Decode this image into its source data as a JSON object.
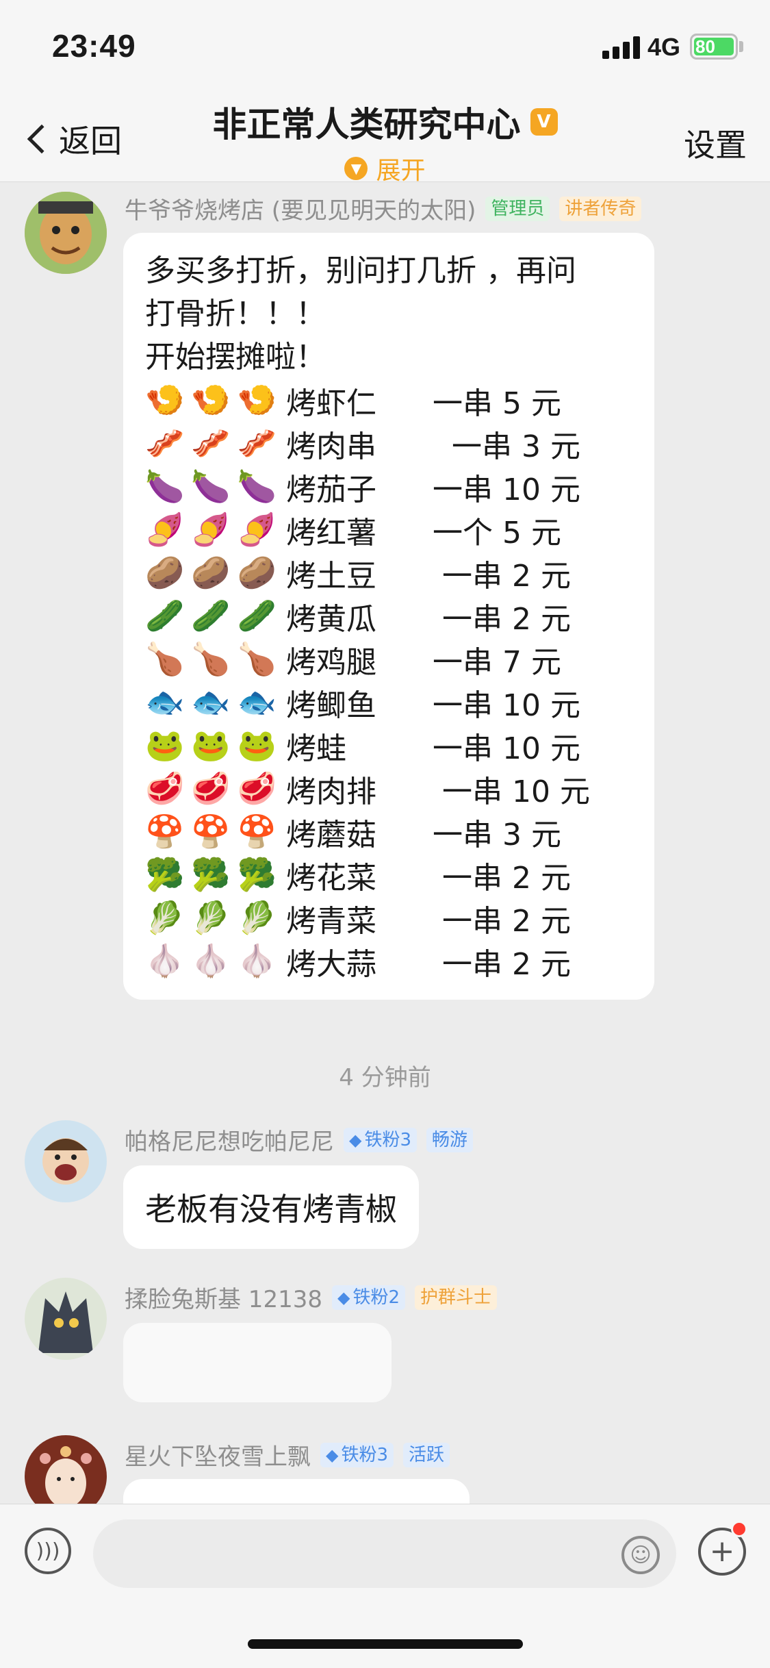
{
  "status_bar": {
    "time": "23:49",
    "network": "4G",
    "battery": "80"
  },
  "nav": {
    "back_label": "返回",
    "title": "非正常人类研究中心",
    "verified_icon_glyph": "V",
    "expand_label": "展开",
    "settings_label": "设置"
  },
  "messages": [
    {
      "sender": "牛爷爷烧烤店 (要见见明天的太阳)",
      "badges": [
        "管理员",
        "讲者传奇"
      ],
      "text_lines": [
        "多买多打折，别问打几折 ，再问",
        "打骨折！！！",
        "开始摆摊啦！"
      ],
      "menu": [
        {
          "emoji": "🍤🍤🍤",
          "name": "烤虾仁",
          "price": "一串 5 元"
        },
        {
          "emoji": "🥓🥓🥓",
          "name": "烤肉串",
          "price": "  一串 3 元"
        },
        {
          "emoji": "🍆🍆🍆",
          "name": "烤茄子",
          "price": "一串 10 元"
        },
        {
          "emoji": "🍠🍠🍠",
          "name": "烤红薯",
          "price": "一个 5 元"
        },
        {
          "emoji": "🥔🥔🥔",
          "name": "烤土豆",
          "price": " 一串 2 元"
        },
        {
          "emoji": "🥒🥒🥒",
          "name": "烤黄瓜",
          "price": " 一串 2 元"
        },
        {
          "emoji": "🍗🍗🍗",
          "name": "烤鸡腿",
          "price": "一串 7 元"
        },
        {
          "emoji": "🐟🐟🐟",
          "name": "烤鲫鱼",
          "price": "一串 10 元"
        },
        {
          "emoji": "🐸🐸🐸",
          "name": "烤蛙",
          "price": "一串 10 元"
        },
        {
          "emoji": "🥩🥩🥩",
          "name": "烤肉排",
          "price": " 一串 10 元"
        },
        {
          "emoji": "🍄🍄🍄",
          "name": "烤蘑菇",
          "price": "一串 3 元"
        },
        {
          "emoji": "🥦🥦🥦",
          "name": "烤花菜",
          "price": " 一串 2 元"
        },
        {
          "emoji": "🥬🥬🥬",
          "name": "烤青菜",
          "price": " 一串 2 元"
        },
        {
          "emoji": "🧄🧄🧄",
          "name": "烤大蒜",
          "price": " 一串 2 元"
        }
      ]
    },
    {
      "sender": "帕格尼尼想吃帕尼尼",
      "badges": [
        "铁粉3",
        "畅游"
      ],
      "text": "老板有没有烤青椒"
    },
    {
      "sender": "揉脸兔斯基 12138",
      "badges": [
        "铁粉2",
        "护群斗士"
      ]
    },
    {
      "sender": "星火下坠夜雪上飘",
      "badges": [
        "铁粉3",
        "活跃"
      ]
    }
  ],
  "time_divider": "4 分钟前",
  "input_bar": {
    "placeholder": ""
  },
  "colors": {
    "accent": "#f5a623",
    "badge_green": "#3fb35f",
    "badge_blue": "#4a8ce6",
    "notify": "#ff3b30"
  }
}
